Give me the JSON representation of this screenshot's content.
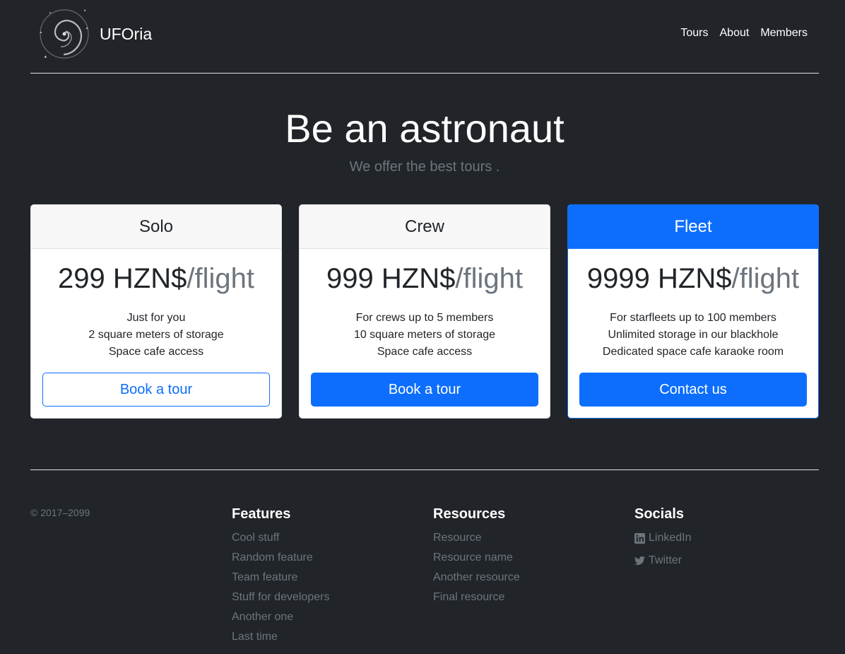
{
  "header": {
    "brand": "UFOria",
    "nav": [
      "Tours",
      "About",
      "Members"
    ]
  },
  "hero": {
    "title": "Be an astronaut",
    "subtitle": "We offer the best tours ."
  },
  "plans": [
    {
      "name": "Solo",
      "price": "299 HZN$",
      "unit": "/flight",
      "features": [
        "Just for you",
        "2 square meters of storage",
        "Space cafe access"
      ],
      "button": "Book a tour"
    },
    {
      "name": "Crew",
      "price": "999 HZN$",
      "unit": "/flight",
      "features": [
        "For crews up to 5 members",
        "10 square meters of storage",
        "Space cafe access"
      ],
      "button": "Book a tour"
    },
    {
      "name": "Fleet",
      "price": "9999 HZN$",
      "unit": "/flight",
      "features": [
        "For starfleets up to 100 members",
        "Unlimited storage in our blackhole",
        "Dedicated space cafe karaoke room"
      ],
      "button": "Contact us"
    }
  ],
  "footer": {
    "copyright": "© 2017–2099",
    "columns": [
      {
        "title": "Features",
        "links": [
          "Cool stuff",
          "Random feature",
          "Team feature",
          "Stuff for developers",
          "Another one",
          "Last time"
        ]
      },
      {
        "title": "Resources",
        "links": [
          "Resource",
          "Resource name",
          "Another resource",
          "Final resource"
        ]
      },
      {
        "title": "Socials",
        "links": [
          "LinkedIn",
          "Twitter"
        ],
        "icons": [
          "linkedin-icon",
          "twitter-icon"
        ]
      }
    ]
  },
  "colors": {
    "background": "#212529",
    "primary": "#0d6efd",
    "muted": "#6c757d"
  }
}
